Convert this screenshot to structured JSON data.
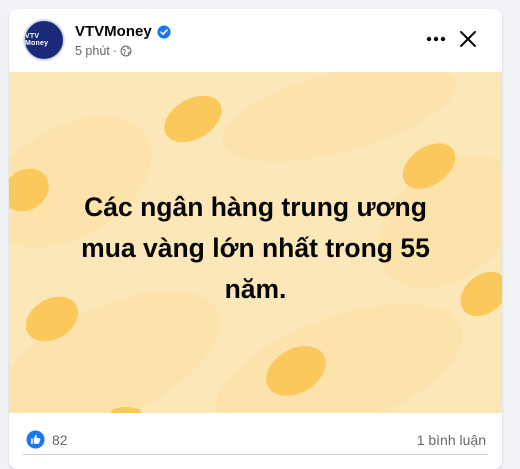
{
  "post": {
    "author": {
      "name": "VTVMoney",
      "avatar_text": "VTV Money",
      "verified": true
    },
    "time": "5 phút",
    "separator": "·",
    "privacy_icon": "globe-icon",
    "text": "Các ngân hàng trung ương\nmua vàng lớn nhất trong 55\nnăm.",
    "background_color": "#fce7b8",
    "blob_color": "#fbc95b"
  },
  "actions": {
    "more_icon": "more-options-icon",
    "close_icon": "close-icon"
  },
  "reactions": {
    "icon": "like-icon",
    "count": "82"
  },
  "comments": {
    "label": "1 bình luận"
  },
  "colors": {
    "accent": "#1877f2",
    "secondary_text": "#65676b"
  }
}
